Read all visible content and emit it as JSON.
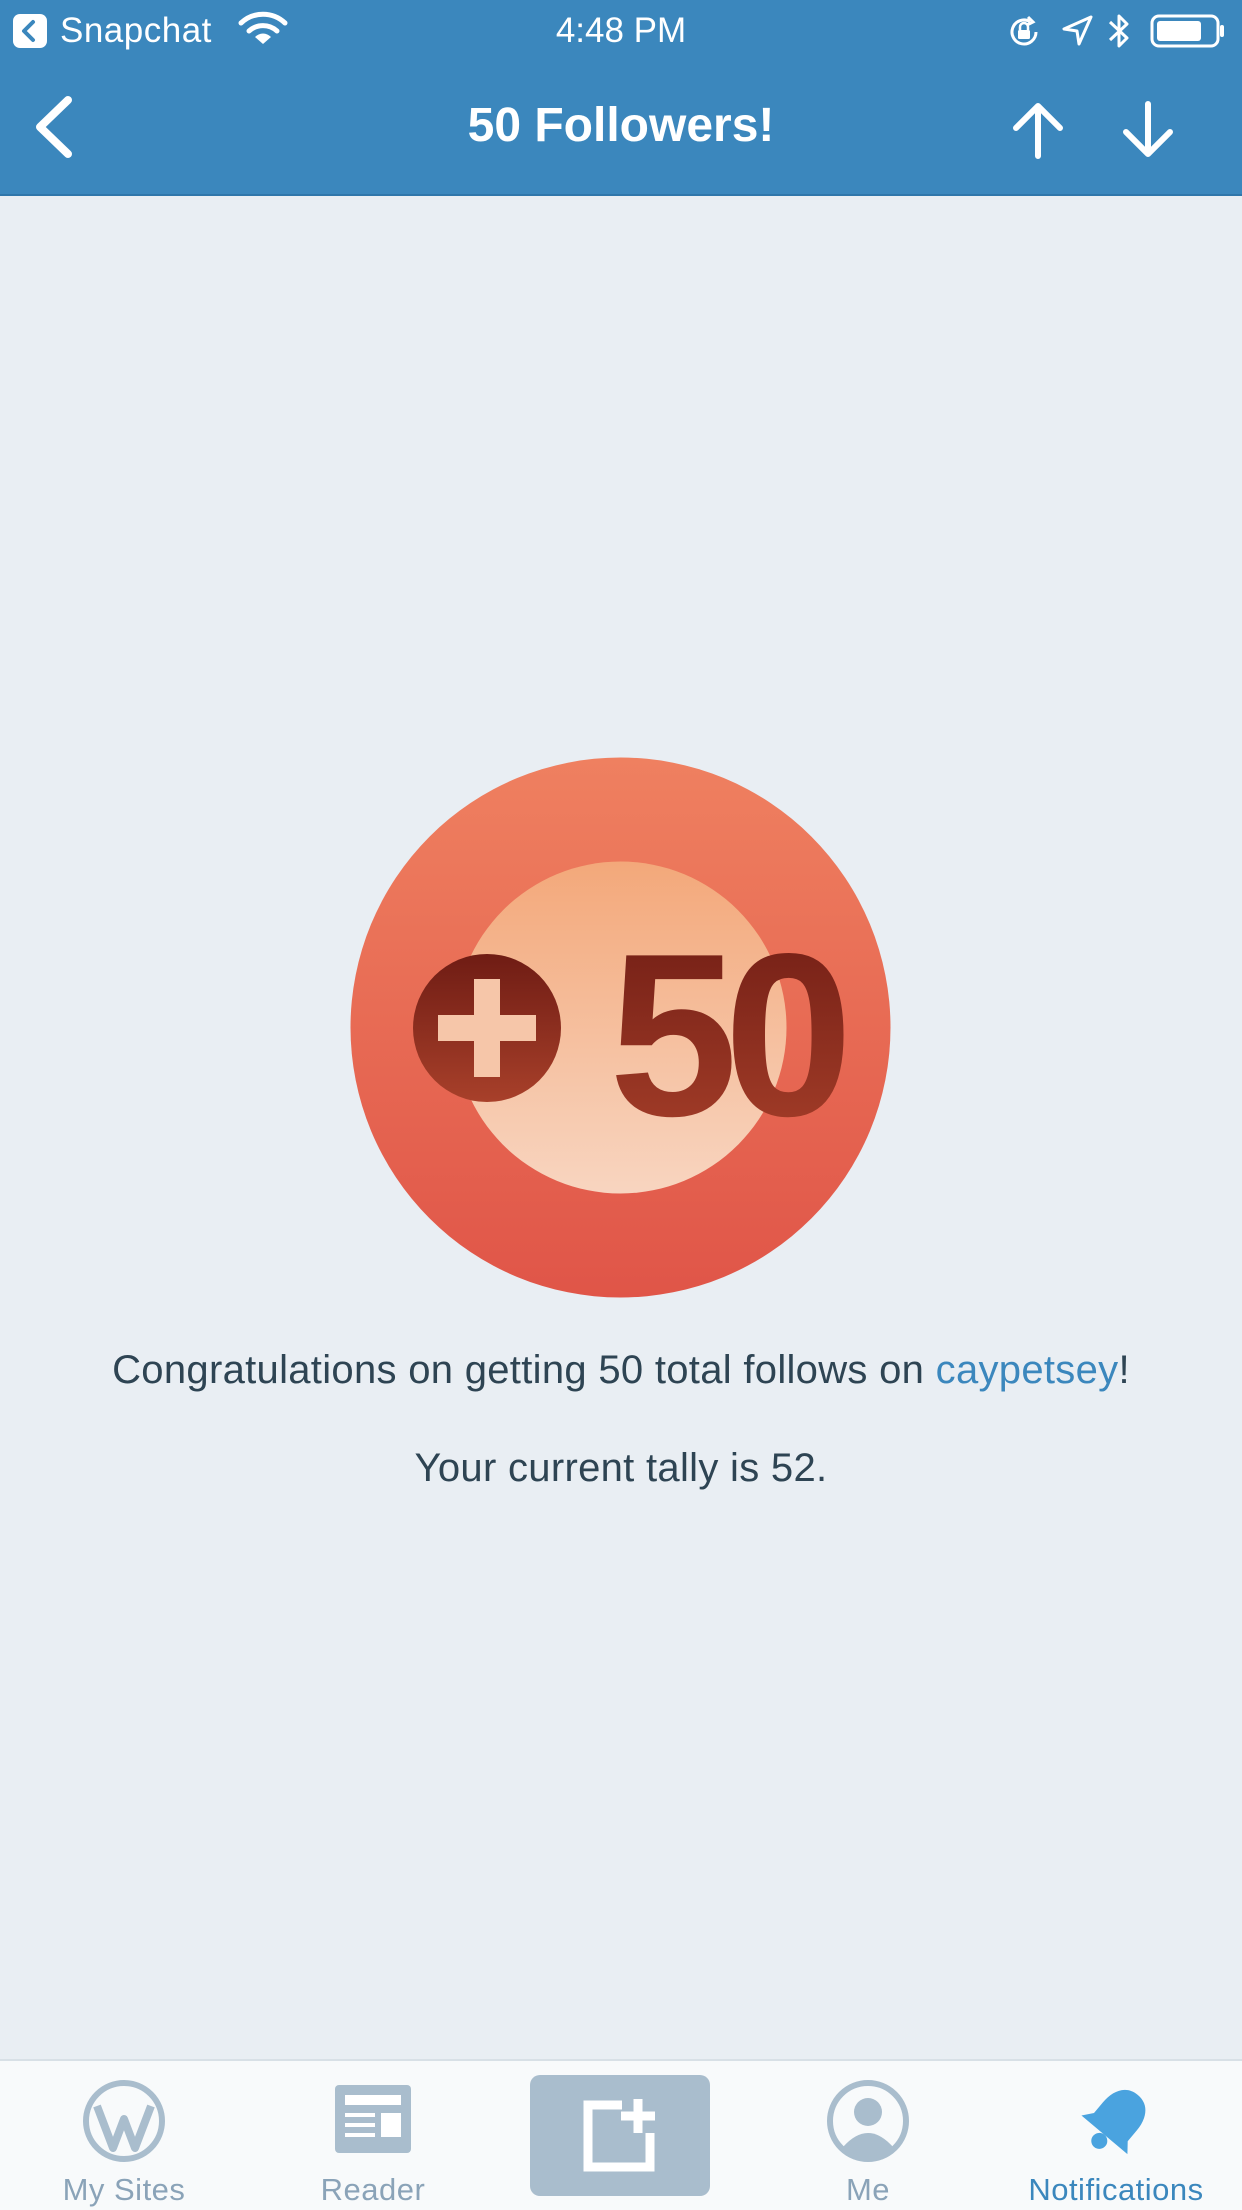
{
  "status_bar": {
    "back_app": "Snapchat",
    "time": "4:48 PM",
    "icons": [
      "back-app-icon",
      "wifi-icon",
      "rotation-lock-icon",
      "location-icon",
      "bluetooth-icon",
      "battery-icon"
    ]
  },
  "nav": {
    "title": "50 Followers!",
    "icons": [
      "back-chevron-icon",
      "arrow-up-icon",
      "arrow-down-icon"
    ]
  },
  "badge": {
    "text": "+50",
    "colors": {
      "outer_top": "#ef8060",
      "outer_bottom": "#e05548",
      "inner_top": "#f3a87a",
      "inner_bottom": "#f8d5c0",
      "text": "#7a2618"
    }
  },
  "message": {
    "line1_prefix": "Congratulations on getting 50 total follows on ",
    "site_link": "caypetsey",
    "line1_suffix": "!",
    "line2": "Your current tally is 52."
  },
  "tabs": {
    "my_sites": "My Sites",
    "reader": "Reader",
    "me": "Me",
    "notifications": "Notifications",
    "active": "notifications"
  },
  "colors": {
    "accent": "#3b87bd",
    "background": "#e9eef3",
    "text": "#2e4453",
    "tab_inactive": "#8aa3b8"
  }
}
